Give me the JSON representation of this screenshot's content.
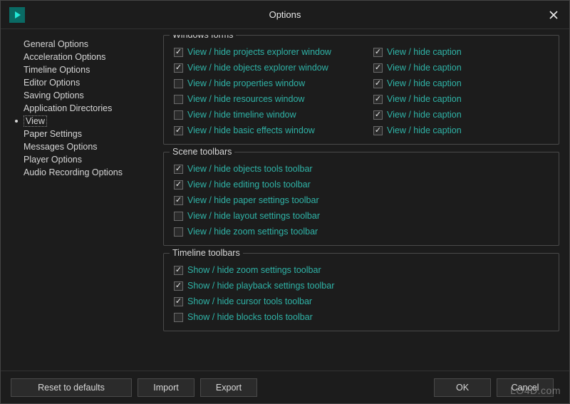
{
  "window": {
    "title": "Options"
  },
  "sidebar": {
    "items": [
      {
        "label": "General Options"
      },
      {
        "label": "Acceleration Options"
      },
      {
        "label": "Timeline Options"
      },
      {
        "label": "Editor Options"
      },
      {
        "label": "Saving Options"
      },
      {
        "label": "Application Directories"
      },
      {
        "label": "View"
      },
      {
        "label": "Paper Settings"
      },
      {
        "label": "Messages Options"
      },
      {
        "label": "Player Options"
      },
      {
        "label": "Audio Recording Options"
      }
    ],
    "selected_index": 6
  },
  "groups": [
    {
      "title": "Windows forms",
      "columns": [
        [
          {
            "checked": true,
            "label": "View / hide projects explorer window"
          },
          {
            "checked": true,
            "label": "View / hide objects explorer window"
          },
          {
            "checked": false,
            "label": "View / hide properties window"
          },
          {
            "checked": false,
            "label": "View / hide resources window"
          },
          {
            "checked": false,
            "label": "View / hide timeline window"
          },
          {
            "checked": true,
            "label": "View / hide basic effects window"
          }
        ],
        [
          {
            "checked": true,
            "label": "View / hide caption"
          },
          {
            "checked": true,
            "label": "View / hide caption"
          },
          {
            "checked": true,
            "label": "View / hide caption"
          },
          {
            "checked": true,
            "label": "View / hide caption"
          },
          {
            "checked": true,
            "label": "View / hide caption"
          },
          {
            "checked": true,
            "label": "View / hide caption"
          }
        ]
      ]
    },
    {
      "title": "Scene toolbars",
      "columns": [
        [
          {
            "checked": true,
            "label": "View / hide objects tools toolbar"
          },
          {
            "checked": true,
            "label": "View / hide editing tools toolbar"
          },
          {
            "checked": true,
            "label": "View / hide paper settings toolbar"
          },
          {
            "checked": false,
            "label": "View / hide layout settings toolbar"
          },
          {
            "checked": false,
            "label": "View / hide zoom settings toolbar"
          }
        ]
      ]
    },
    {
      "title": "Timeline toolbars",
      "columns": [
        [
          {
            "checked": true,
            "label": "Show / hide zoom settings toolbar"
          },
          {
            "checked": true,
            "label": "Show / hide playback settings toolbar"
          },
          {
            "checked": true,
            "label": "Show / hide cursor tools toolbar"
          },
          {
            "checked": false,
            "label": "Show / hide blocks tools toolbar"
          }
        ]
      ]
    }
  ],
  "footer": {
    "reset": "Reset to defaults",
    "import": "Import",
    "export": "Export",
    "ok": "OK",
    "cancel": "Cancel"
  },
  "watermark": "LO4D.com"
}
